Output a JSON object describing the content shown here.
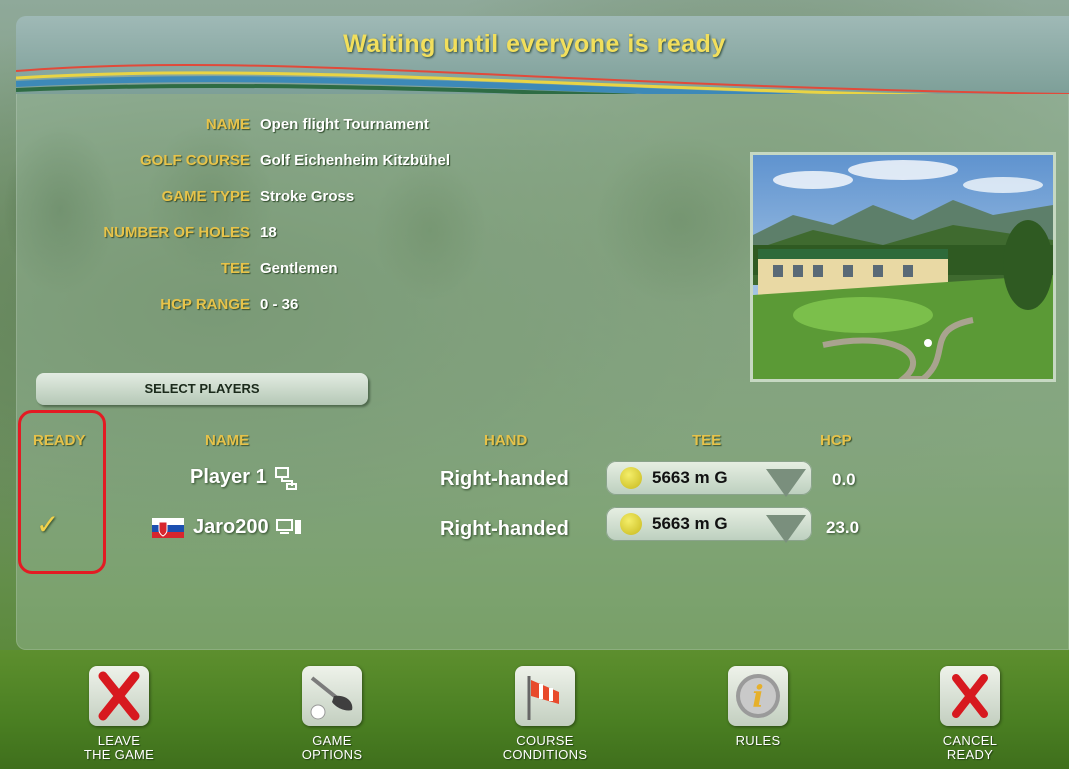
{
  "title": "Waiting until everyone is ready",
  "info": [
    {
      "label": "NAME",
      "value": "Open flight Tournament"
    },
    {
      "label": "GOLF COURSE",
      "value": "Golf Eichenheim Kitzbühel"
    },
    {
      "label": "GAME TYPE",
      "value": "Stroke Gross"
    },
    {
      "label": "NUMBER OF HOLES",
      "value": "18"
    },
    {
      "label": "TEE",
      "value": "Gentlemen"
    },
    {
      "label": "HCP RANGE",
      "value": "0 - 36"
    }
  ],
  "select_players_label": "SELECT PLAYERS",
  "columns": {
    "ready": "READY",
    "name": "NAME",
    "hand": "HAND",
    "tee": "TEE",
    "hcp": "HCP"
  },
  "players": [
    {
      "ready": "",
      "name": "Player 1",
      "hand": "Right-handed",
      "tee": "5663 m  G",
      "hcp": "0.0"
    },
    {
      "ready": "✓",
      "name": "Jaro200",
      "hand": "Right-handed",
      "tee": "5663 m  G",
      "hcp": "23.0"
    }
  ],
  "toolbar": {
    "leave": {
      "line1": "LEAVE",
      "line2": "THE GAME"
    },
    "game_options": {
      "line1": "GAME",
      "line2": "OPTIONS"
    },
    "course_conditions": {
      "line1": "COURSE",
      "line2": "CONDITIONS"
    },
    "rules": {
      "line1": "RULES",
      "line2": ""
    },
    "cancel_ready": {
      "line1": "CANCEL",
      "line2": "READY"
    }
  },
  "colors": {
    "accent": "#e7c34a",
    "highlight": "#e31b23",
    "tee_dot": "#e5dc3a"
  }
}
